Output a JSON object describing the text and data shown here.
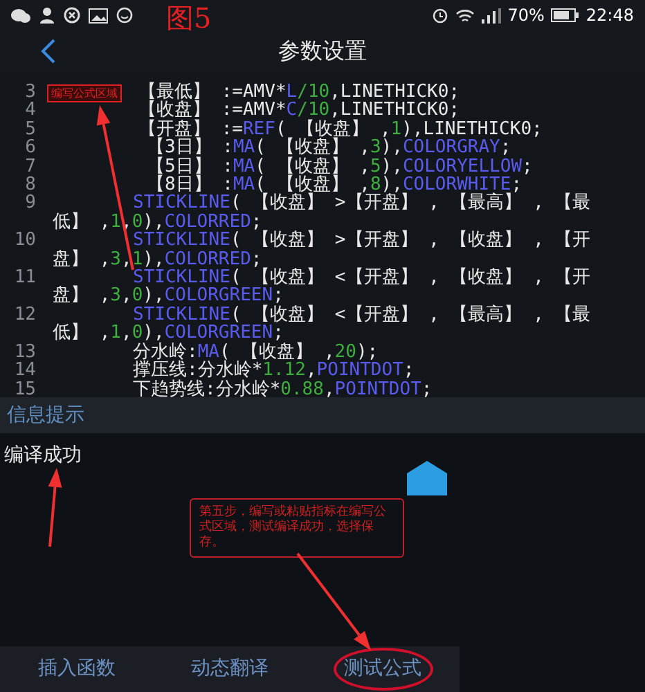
{
  "status_bar": {
    "battery_percent": "70%",
    "time": "22:48"
  },
  "annotation_figure": "图5",
  "header": {
    "title": "参数设置"
  },
  "editor": {
    "area_label": "编写公式区域",
    "lines": [
      {
        "number": "3",
        "kind": "shallow",
        "tokens": [
          {
            "kind": "text",
            "text": "【最低】 :=AMV*"
          },
          {
            "kind": "func",
            "text": "L"
          },
          {
            "kind": "num",
            "text": "/10"
          },
          {
            "kind": "text",
            "text": ",LINETHICK0;"
          }
        ]
      },
      {
        "number": "4",
        "kind": "shallow",
        "tokens": [
          {
            "kind": "text",
            "text": "【收盘】 :=AMV*"
          },
          {
            "kind": "func",
            "text": "C"
          },
          {
            "kind": "num",
            "text": "/10"
          },
          {
            "kind": "text",
            "text": ",LINETHICK0;"
          }
        ]
      },
      {
        "number": "5",
        "kind": "shallow",
        "tokens": [
          {
            "kind": "text",
            "text": "【开盘】 :="
          },
          {
            "kind": "func",
            "text": "REF"
          },
          {
            "kind": "text",
            "text": "( 【收盘】 ,"
          },
          {
            "kind": "num",
            "text": "1"
          },
          {
            "kind": "text",
            "text": "),LINETHICK0;"
          }
        ]
      },
      {
        "number": "6",
        "kind": "deep",
        "tokens": [
          {
            "kind": "text",
            "text": "【3日】 :"
          },
          {
            "kind": "func",
            "text": "MA"
          },
          {
            "kind": "text",
            "text": "( 【收盘】 ,"
          },
          {
            "kind": "num",
            "text": "3"
          },
          {
            "kind": "text",
            "text": "),"
          },
          {
            "kind": "func",
            "text": "COLORGRAY"
          },
          {
            "kind": "text",
            "text": ";"
          }
        ]
      },
      {
        "number": "7",
        "kind": "deep",
        "tokens": [
          {
            "kind": "text",
            "text": "【5日】 :"
          },
          {
            "kind": "func",
            "text": "MA"
          },
          {
            "kind": "text",
            "text": "( 【收盘】 ,"
          },
          {
            "kind": "num",
            "text": "5"
          },
          {
            "kind": "text",
            "text": "),"
          },
          {
            "kind": "func",
            "text": "COLORYELLOW"
          },
          {
            "kind": "text",
            "text": ";"
          }
        ]
      },
      {
        "number": "8",
        "kind": "deep",
        "tokens": [
          {
            "kind": "text",
            "text": "【8日】 :"
          },
          {
            "kind": "func",
            "text": "MA"
          },
          {
            "kind": "text",
            "text": "( 【收盘】 ,"
          },
          {
            "kind": "num",
            "text": "8"
          },
          {
            "kind": "text",
            "text": "),"
          },
          {
            "kind": "func",
            "text": "COLORWHITE"
          },
          {
            "kind": "text",
            "text": ";"
          }
        ]
      },
      {
        "number": "9",
        "kind": "near",
        "tokens": [
          {
            "kind": "func",
            "text": "STICKLINE"
          },
          {
            "kind": "text",
            "text": "( 【收盘】 >【开盘】 , 【最高】 , 【最低】 ,"
          },
          {
            "kind": "num",
            "text": "1"
          },
          {
            "kind": "text",
            "text": ","
          },
          {
            "kind": "num",
            "text": "0"
          },
          {
            "kind": "text",
            "text": "),"
          },
          {
            "kind": "func",
            "text": "COLORRED"
          },
          {
            "kind": "text",
            "text": ";"
          }
        ]
      },
      {
        "number": "10",
        "kind": "near",
        "tokens": [
          {
            "kind": "func",
            "text": "STICKLINE"
          },
          {
            "kind": "text",
            "text": "( 【收盘】 >【开盘】 , 【收盘】 , 【开盘】 ,"
          },
          {
            "kind": "num",
            "text": "3"
          },
          {
            "kind": "text",
            "text": ","
          },
          {
            "kind": "num",
            "text": "1"
          },
          {
            "kind": "text",
            "text": "),"
          },
          {
            "kind": "func",
            "text": "COLORRED"
          },
          {
            "kind": "text",
            "text": ";"
          }
        ]
      },
      {
        "number": "11",
        "kind": "near",
        "tokens": [
          {
            "kind": "func",
            "text": "STICKLINE"
          },
          {
            "kind": "text",
            "text": "( 【收盘】 <【开盘】 , 【收盘】 , 【开盘】 ,"
          },
          {
            "kind": "num",
            "text": "3"
          },
          {
            "kind": "text",
            "text": ","
          },
          {
            "kind": "num",
            "text": "0"
          },
          {
            "kind": "text",
            "text": "),"
          },
          {
            "kind": "func",
            "text": "COLORGREEN"
          },
          {
            "kind": "text",
            "text": ";"
          }
        ]
      },
      {
        "number": "12",
        "kind": "near",
        "tokens": [
          {
            "kind": "func",
            "text": "STICKLINE"
          },
          {
            "kind": "text",
            "text": "( 【收盘】 <【开盘】 , 【最高】 , 【最低】 ,"
          },
          {
            "kind": "num",
            "text": "1"
          },
          {
            "kind": "text",
            "text": ","
          },
          {
            "kind": "num",
            "text": "0"
          },
          {
            "kind": "text",
            "text": "),"
          },
          {
            "kind": "func",
            "text": "COLORGREEN"
          },
          {
            "kind": "text",
            "text": ";"
          }
        ]
      },
      {
        "number": "13",
        "kind": "near",
        "tokens": [
          {
            "kind": "text",
            "text": "分水岭:"
          },
          {
            "kind": "func",
            "text": "MA"
          },
          {
            "kind": "text",
            "text": "( 【收盘】 ,"
          },
          {
            "kind": "num",
            "text": "20"
          },
          {
            "kind": "text",
            "text": ");"
          }
        ]
      },
      {
        "number": "14",
        "kind": "near",
        "tokens": [
          {
            "kind": "text",
            "text": "撑压线:分水岭*"
          },
          {
            "kind": "num",
            "text": "1.12"
          },
          {
            "kind": "text",
            "text": ","
          },
          {
            "kind": "func",
            "text": "POINTDOT"
          },
          {
            "kind": "text",
            "text": ";"
          }
        ]
      },
      {
        "number": "15",
        "kind": "near",
        "tokens": [
          {
            "kind": "text",
            "text": "下趋势线:分水岭*"
          },
          {
            "kind": "num",
            "text": "0.88"
          },
          {
            "kind": "text",
            "text": ","
          },
          {
            "kind": "func",
            "text": "POINTDOT"
          },
          {
            "kind": "text",
            "text": ";"
          }
        ]
      }
    ]
  },
  "info": {
    "title": "信息提示",
    "message": "编译成功"
  },
  "annotation_note": "第五步，编写或粘贴指标在编写公式区域，测试编译成功，选择保存。",
  "bottom_tabs": [
    {
      "label": "插入函数",
      "circled": false
    },
    {
      "label": "动态翻译",
      "circled": false
    },
    {
      "label": "测试公式",
      "circled": true
    }
  ]
}
